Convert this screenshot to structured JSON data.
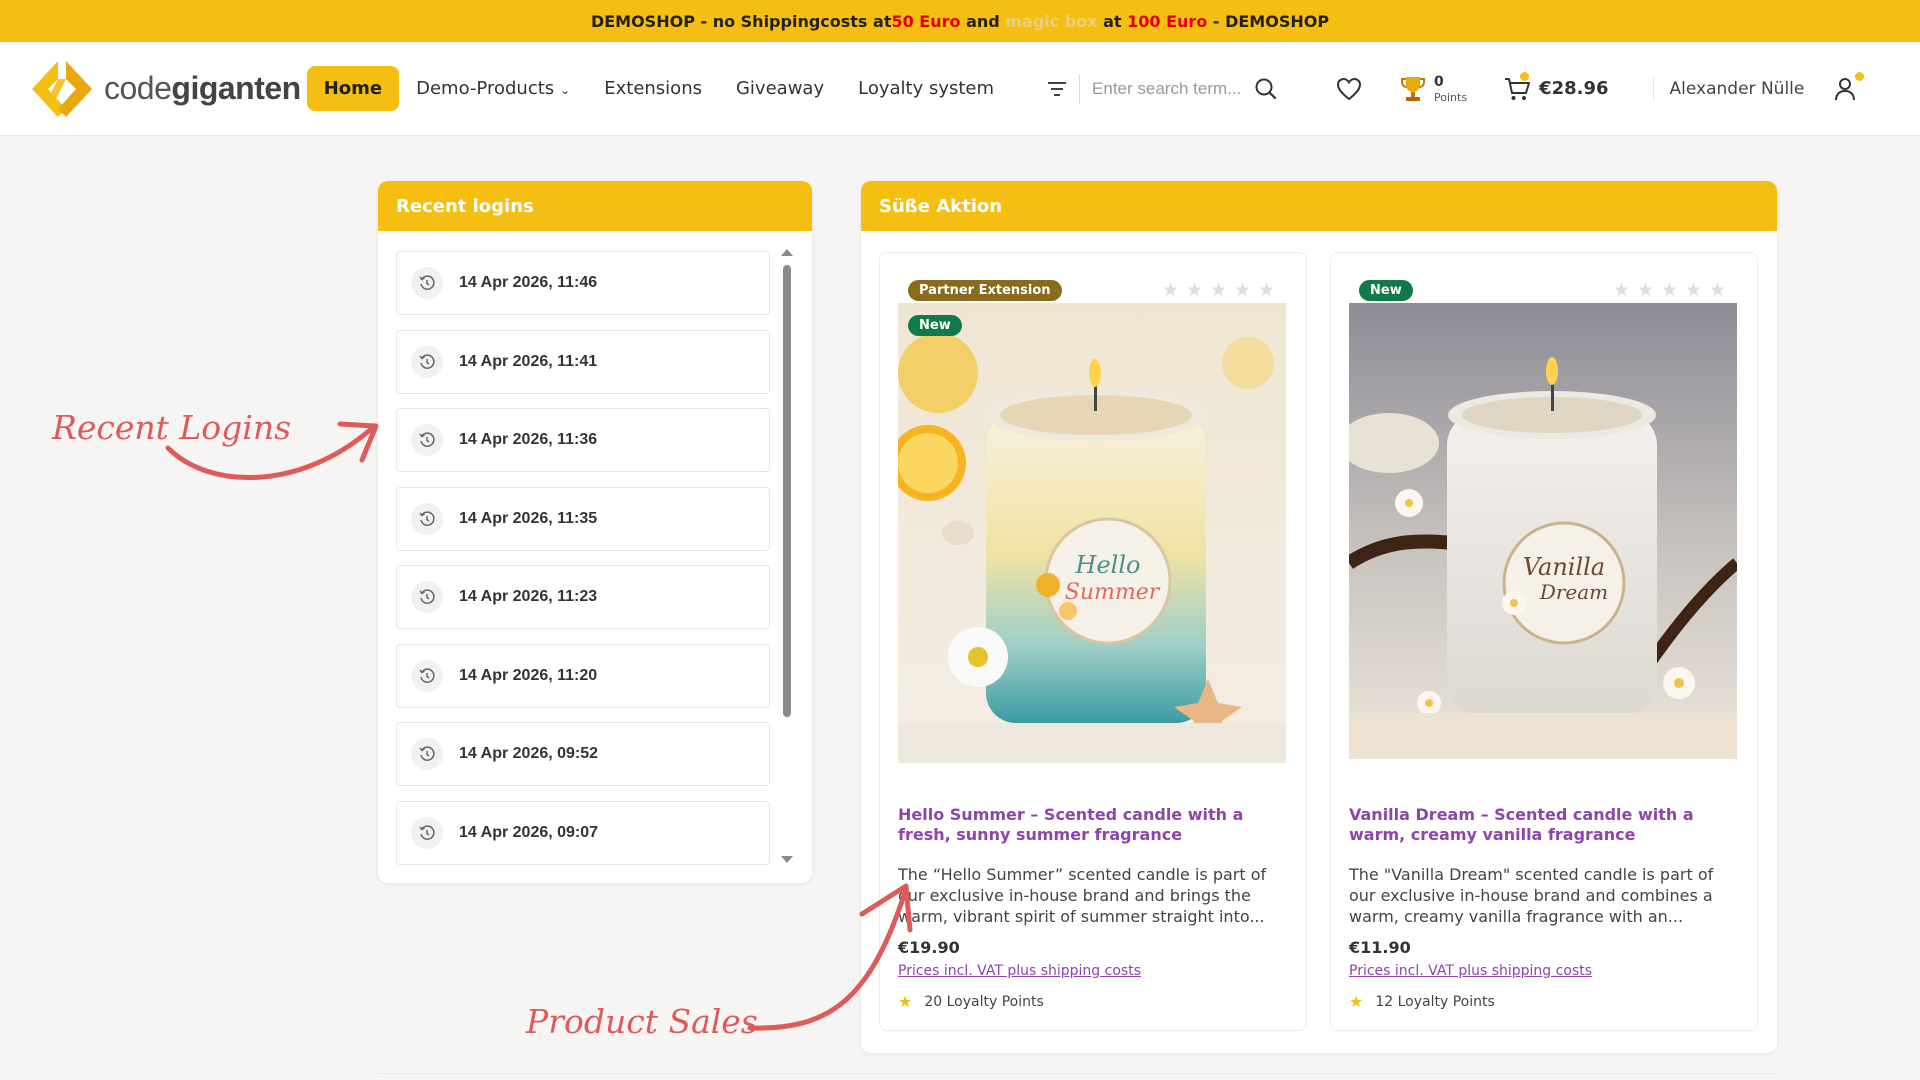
{
  "banner": {
    "part1": "DEMOSHOP - no Shippingcosts at ",
    "amount1": "50 Euro",
    "part2": " and ",
    "faint": "magic box",
    "part3": " at ",
    "amount2": "100 Euro",
    "part4": " - DEMOSHOP"
  },
  "header": {
    "logo_light": "code",
    "logo_bold": "giganten",
    "nav": [
      {
        "label": "Home"
      },
      {
        "label": "Demo-Products"
      },
      {
        "label": "Extensions"
      },
      {
        "label": "Giveaway"
      },
      {
        "label": "Loyalty system"
      }
    ],
    "search_placeholder": "Enter search term...",
    "points_value": "0",
    "points_label": "Points",
    "cart_amount": "€28.96",
    "user_name": "Alexander Nülle"
  },
  "colors": {
    "accent": "#f5be13",
    "link": "#8e44ad",
    "new_badge": "#127a4a",
    "partner_badge": "#8a6a1c",
    "annotation": "#e05a5a"
  },
  "logins": {
    "title": "Recent logins",
    "items": [
      "14 Apr 2026, 11:46",
      "14 Apr 2026, 11:41",
      "14 Apr 2026, 11:36",
      "14 Apr 2026, 11:35",
      "14 Apr 2026, 11:23",
      "14 Apr 2026, 11:20",
      "14 Apr 2026, 09:52",
      "14 Apr 2026, 09:07"
    ]
  },
  "promo": {
    "title": "Süße Aktion",
    "products": [
      {
        "badge_partner": "Partner Extension",
        "badge_new": "New",
        "label_line1": "Hello",
        "label_line2": "Summer",
        "title": "Hello Summer – Scented candle with a fresh, sunny summer fragrance",
        "description": "The “Hello Summer” scented candle is part of our exclusive in-house brand and brings the warm, vibrant spirit of summer straight into...",
        "price": "€19.90",
        "vat": "Prices incl. VAT plus shipping costs",
        "loyalty": "20 Loyalty Points"
      },
      {
        "badge_new": "New",
        "label_line1": "Vanilla",
        "label_line2": "Dream",
        "title": "Vanilla Dream – Scented candle with a warm, creamy vanilla fragrance",
        "description": "The \"Vanilla Dream\" scented candle is part of our exclusive in-house brand and combines a warm, creamy vanilla fragrance with an...",
        "price": "€11.90",
        "vat": "Prices incl. VAT plus shipping costs",
        "loyalty": "12 Loyalty Points"
      }
    ]
  },
  "annotations": {
    "recent_logins": "Recent Logins",
    "product_sales": "Product Sales"
  }
}
